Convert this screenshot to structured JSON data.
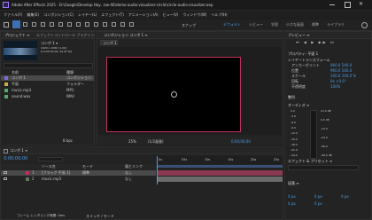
{
  "titlebar": {
    "title": "Adobe After Effects 2025 - D:\\Google\\Develop Hay...\\ae-AE\\demo-audio-visualizer-circle\\circle-audio-visualizer.aep"
  },
  "menu": [
    "ファイル(F)",
    "編集(E)",
    "コンポジション(C)",
    "レイヤー(L)",
    "エフェクト(T)",
    "アニメーション(A)",
    "ビュー(V)",
    "ウィンドウ(W)",
    "ヘルプ(H)"
  ],
  "toolbar": {
    "workspaces": [
      "デフォルト",
      "レビュー",
      "学習",
      "小さな画面",
      "標準",
      "ライブラリ"
    ],
    "active_workspace": "デフォルト",
    "snap_label": "スナップ"
  },
  "project": {
    "tab": "プロジェクト ≡",
    "effects_tab": "エフェクトコントロール プラグインな",
    "selected_name": "コンポ 1 ▾",
    "selected_info": [
      "1920 x 1080 (1.00)",
      "Δ 0;00;30;00, 29.97 fps"
    ],
    "col_name": "名前",
    "col_type": "種類",
    "items": [
      {
        "name": "コンポ 1",
        "type": "コンポジション"
      },
      {
        "name": "平面",
        "type": "フォルダー"
      },
      {
        "name": "music.mp3",
        "type": "MP3"
      },
      {
        "name": "sound.wav",
        "type": "WAV"
      }
    ],
    "footer": "8 bpc"
  },
  "composition": {
    "tab": "コンポジション コンポ 1 ≡",
    "comp_label": "コンポ 1",
    "zoom": "25%",
    "quality": "(1/2画質)",
    "timecode": "0;00;00;00"
  },
  "right_panel": {
    "preview_title": "プレビュー ≡",
    "props_title": "プロパティ: 平面 1",
    "layer_transform": "レイヤートランスフォーム",
    "props": [
      {
        "label": "アンカーポイント",
        "value": "960.0  540.0"
      },
      {
        "label": "位置",
        "value": "960.0  540.0"
      },
      {
        "label": "スケール",
        "value": "100.0  100.0 %"
      },
      {
        "label": "回転",
        "value": "0x +0.0°"
      },
      {
        "label": "不透明度",
        "value": "100%"
      }
    ],
    "align_title": "整列",
    "audio_title": "オーディオ ≡",
    "audio_scale": [
      "0.0",
      "-3.0",
      "-6.0",
      "-9.0",
      "-12.0",
      "-15.0",
      "-18.0",
      "-21.0",
      "-24.0"
    ],
    "audio_scale_right": [
      "12.0 dB",
      "0.0 dB",
      "-12.0",
      "-24.0",
      "-36.0",
      "-48.0 dB"
    ],
    "effects_presets": "エフェクト & プリセット ≡",
    "paragraph": "段落 ≡",
    "para_values": [
      "0 px",
      "0 px",
      "0 px",
      "0 px",
      "0 px"
    ]
  },
  "timeline": {
    "tab": "コンポ 1 ≡",
    "timecode": "0;00;00;00",
    "col_source": "ソース名",
    "col_mode": "モード",
    "col_parent": "親とリンク",
    "layers": [
      {
        "num": "1",
        "name": "[ブラック 平面 1]",
        "mode": "標準",
        "parent": "なし"
      },
      {
        "num": "2",
        "name": "music.mp3",
        "mode": "",
        "parent": "なし"
      }
    ],
    "ruler": [
      "0s",
      "05s",
      "10s",
      "15s",
      "20s",
      "25s"
    ],
    "footer": "フレーム レンダリング時間:  0ms",
    "footer_mode": "スイッチ / モード"
  }
}
